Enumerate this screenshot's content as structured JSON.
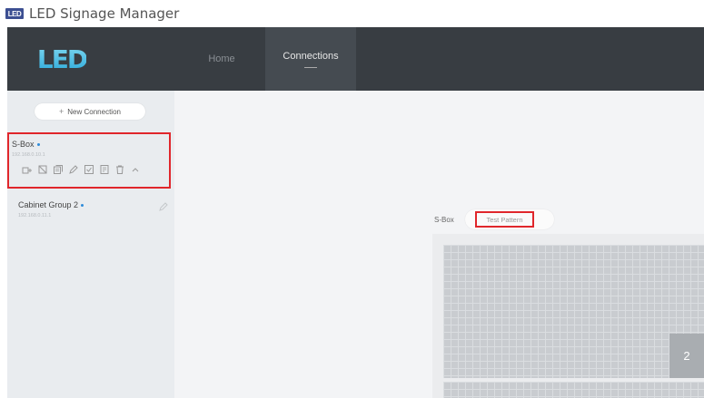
{
  "window": {
    "logo_text": "LED",
    "title": "LED Signage Manager"
  },
  "header": {
    "brand": "LED",
    "tabs": [
      {
        "label": "Home",
        "active": false
      },
      {
        "label": "Connections",
        "active": true
      }
    ]
  },
  "sidebar": {
    "new_connection_label": "New Connection",
    "connections": [
      {
        "name": "S-Box",
        "ip": "192.168.0.10.1",
        "selected": true,
        "actions": [
          "add-group-icon",
          "unlink-icon",
          "copy-icon",
          "edit-icon",
          "check-box-icon",
          "document-icon",
          "trash-icon",
          "chevron-up-icon"
        ]
      },
      {
        "name": "Cabinet Group 2",
        "ip": "192.168.0.11.1",
        "selected": false
      }
    ]
  },
  "main": {
    "device_label": "S-Box",
    "test_pattern_label": "Test Pattern",
    "cabinet_number": "2"
  },
  "colors": {
    "header_bg": "#383d42",
    "sidebar_bg": "#e9ecef",
    "highlight_red": "#e0262b",
    "status_dot": "#2e8cd9"
  }
}
